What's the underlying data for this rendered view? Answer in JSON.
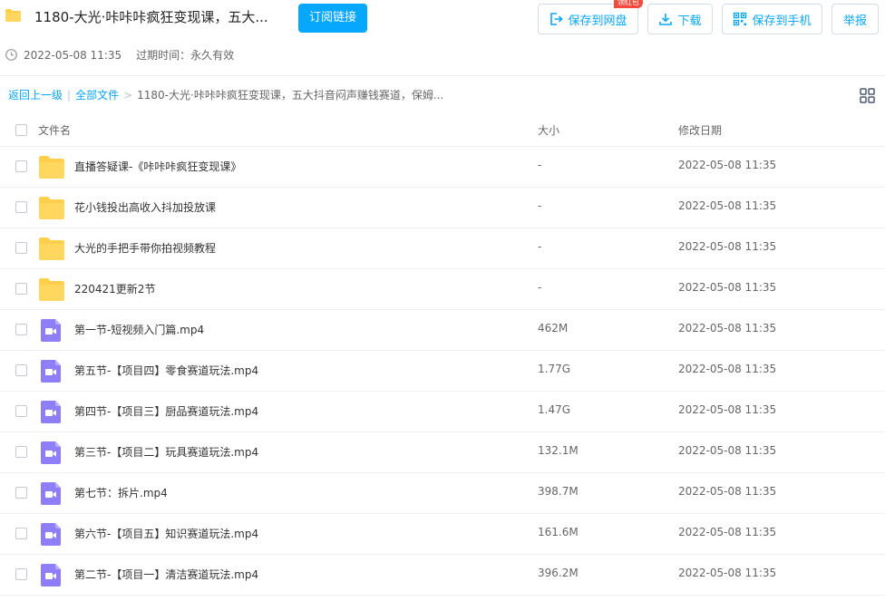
{
  "header": {
    "title": "1180-大光·咔咔咔疯狂变现课，五大...",
    "subscribe_label": "订阅链接",
    "share_time": "2022-05-08 11:35",
    "expire_text": "过期时间：永久有效",
    "actions": {
      "save_disk": "保存到网盘",
      "download": "下载",
      "save_phone": "保存到手机",
      "report": "举报",
      "hongbao_badge": "领红包"
    }
  },
  "breadcrumb": {
    "back": "返回上一级",
    "divider": "|",
    "all_files": "全部文件",
    "arrow": ">",
    "current": "1180-大光·咔咔咔疯狂变现课，五大抖音闷声赚钱赛道，保姆..."
  },
  "columns": {
    "name": "文件名",
    "size": "大小",
    "date": "修改日期"
  },
  "files": [
    {
      "type": "folder",
      "name": "直播答疑课-《咔咔咔疯狂变现课》",
      "size": "-",
      "date": "2022-05-08 11:35"
    },
    {
      "type": "folder",
      "name": "花小钱投出高收入抖加投放课",
      "size": "-",
      "date": "2022-05-08 11:35"
    },
    {
      "type": "folder",
      "name": "大光的手把手带你拍视频教程",
      "size": "-",
      "date": "2022-05-08 11:35"
    },
    {
      "type": "folder",
      "name": "220421更新2节",
      "size": "-",
      "date": "2022-05-08 11:35"
    },
    {
      "type": "video",
      "name": "第一节-短视频入门篇.mp4",
      "size": "462M",
      "date": "2022-05-08 11:35"
    },
    {
      "type": "video",
      "name": "第五节-【项目四】零食赛道玩法.mp4",
      "size": "1.77G",
      "date": "2022-05-08 11:35"
    },
    {
      "type": "video",
      "name": "第四节-【项目三】厨品赛道玩法.mp4",
      "size": "1.47G",
      "date": "2022-05-08 11:35"
    },
    {
      "type": "video",
      "name": "第三节-【项目二】玩具赛道玩法.mp4",
      "size": "132.1M",
      "date": "2022-05-08 11:35"
    },
    {
      "type": "video",
      "name": "第七节：拆片.mp4",
      "size": "398.7M",
      "date": "2022-05-08 11:35"
    },
    {
      "type": "video",
      "name": "第六节-【项目五】知识赛道玩法.mp4",
      "size": "161.6M",
      "date": "2022-05-08 11:35"
    },
    {
      "type": "video",
      "name": "第二节-【项目一】清洁赛道玩法.mp4",
      "size": "396.2M",
      "date": "2022-05-08 11:35"
    }
  ],
  "colors": {
    "accent": "#06a7ff",
    "folder": "#ffcf4b",
    "video": "#8e7ef7",
    "badge": "#f34a3c"
  }
}
